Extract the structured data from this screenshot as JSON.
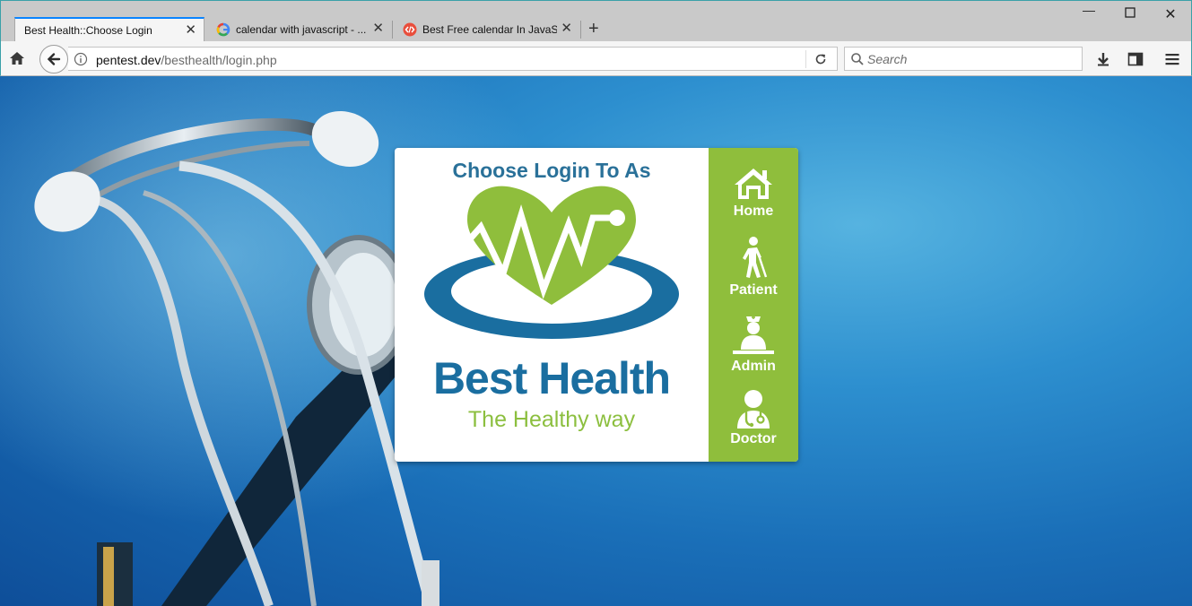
{
  "browser": {
    "tabs": [
      {
        "title": "Best Health::Choose Login",
        "active": true
      },
      {
        "title": "calendar with javascript - ...",
        "active": false,
        "favicon": "google-icon"
      },
      {
        "title": "Best Free calendar In JavaS...",
        "active": false,
        "favicon": "code-icon"
      }
    ],
    "url": {
      "host": "pentest.dev",
      "path": "/besthealth/login.php"
    },
    "search": {
      "placeholder": "Search"
    }
  },
  "page": {
    "card_title": "Choose Login To As",
    "brand": {
      "name": "Best Health",
      "tagline": "The Healthy way"
    },
    "roles": [
      {
        "label": "Home",
        "icon": "home-icon"
      },
      {
        "label": "Patient",
        "icon": "patient-icon"
      },
      {
        "label": "Admin",
        "icon": "admin-icon"
      },
      {
        "label": "Doctor",
        "icon": "doctor-icon"
      }
    ]
  },
  "colors": {
    "brand_blue": "#1a6ea0",
    "brand_green": "#8fbe3c",
    "title_blue": "#2a7199"
  }
}
